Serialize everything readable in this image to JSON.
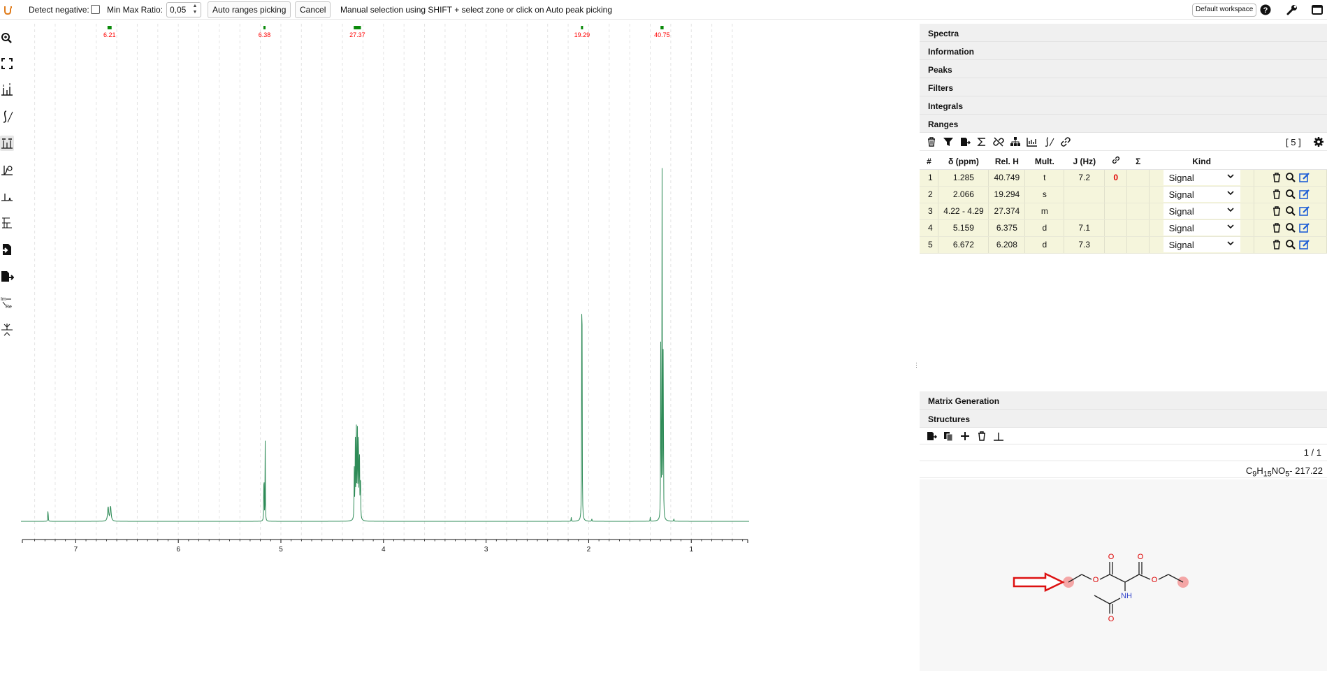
{
  "toolbar": {
    "detect_negative_label": "Detect negative:",
    "detect_negative_checked": false,
    "min_max_ratio_label": "Min Max Ratio:",
    "min_max_ratio_value": "0,05",
    "auto_ranges_label": "Auto ranges picking",
    "cancel_label": "Cancel",
    "hint": "Manual selection using SHIFT + select zone or click on Auto peak picking",
    "workspace_label": "Default workspace",
    "icons": [
      "app-logo-icon",
      "help-icon",
      "wrench-icon",
      "window-icon"
    ]
  },
  "left_tools": [
    "zoom-icon",
    "fullscreen-icon",
    "peak-picking-icon",
    "integral-icon",
    "ranges-picking-icon",
    "phase-correction-icon",
    "baseline-correction-icon",
    "multiplet-analysis-icon",
    "import-icon",
    "export-icon",
    "real-imaginary-icon",
    "spectra-alignment-icon"
  ],
  "chart_data": {
    "type": "line",
    "x_axis": {
      "reversed": true,
      "xlim": [
        7.52,
        0.45
      ],
      "ticks": [
        7,
        6,
        5,
        4,
        3,
        2,
        1
      ],
      "tick_labels": [
        "7",
        "6",
        "5",
        "4",
        "3",
        "2",
        "1"
      ]
    },
    "peaks": [
      {
        "ppm": 7.27,
        "height": 0.04
      },
      {
        "ppm": 6.672,
        "height": 0.038
      },
      {
        "ppm": 5.159,
        "height": 0.2
      },
      {
        "ppm": 4.255,
        "height": 0.25
      },
      {
        "ppm": 2.066,
        "height": 0.96
      },
      {
        "ppm": 1.285,
        "height": 1.0
      },
      {
        "ppm": 2.17,
        "height": 0.01
      },
      {
        "ppm": 1.97,
        "height": 0.008
      },
      {
        "ppm": 1.4,
        "height": 0.01
      },
      {
        "ppm": 1.17,
        "height": 0.008
      }
    ],
    "range_markers": [
      {
        "from": 6.69,
        "to": 6.65,
        "label": "6.21"
      },
      {
        "from": 5.17,
        "to": 5.15,
        "label": "6.38"
      },
      {
        "from": 4.29,
        "to": 4.22,
        "label": "27.37"
      },
      {
        "from": 2.07,
        "to": 2.06,
        "label": "19.29"
      },
      {
        "from": 1.3,
        "to": 1.27,
        "label": "40.75"
      }
    ],
    "line_color": "#2e8b57",
    "marker_color": "#0b8a0b",
    "marker_label_color": "#ff0000",
    "grid": true,
    "grid_style": "dashed-vertical"
  },
  "panel": {
    "sections_top": [
      "Spectra",
      "Information",
      "Peaks",
      "Filters",
      "Integrals",
      "Ranges"
    ],
    "ranges_toolbar_icons": [
      "delete-icon",
      "filter-icon",
      "export-icon",
      "sum-icon",
      "unlink-icon",
      "tree-icon",
      "chart-icon",
      "integral-icon",
      "link-icon"
    ],
    "ranges_count": "[ 5 ]",
    "columns": [
      "#",
      "δ (ppm)",
      "Rel. H",
      "Mult.",
      "J (Hz)",
      "Σ",
      "Kind"
    ],
    "rows": [
      {
        "idx": "1",
        "delta": "1.285",
        "relh": "40.749",
        "mult": "t",
        "j": "7.2",
        "link": "0",
        "kind": "Signal"
      },
      {
        "idx": "2",
        "delta": "2.066",
        "relh": "19.294",
        "mult": "s",
        "j": "",
        "link": "",
        "kind": "Signal"
      },
      {
        "idx": "3",
        "delta": "4.22 - 4.29",
        "relh": "27.374",
        "mult": "m",
        "j": "",
        "link": "",
        "kind": "Signal"
      },
      {
        "idx": "4",
        "delta": "5.159",
        "relh": "6.375",
        "mult": "d",
        "j": "7.1",
        "link": "",
        "kind": "Signal"
      },
      {
        "idx": "5",
        "delta": "6.672",
        "relh": "6.208",
        "mult": "d",
        "j": "7.3",
        "link": "",
        "kind": "Signal"
      }
    ],
    "sections_bottom": [
      "Matrix Generation",
      "Structures"
    ],
    "structures_toolbar_icons": [
      "export-icon",
      "copy-icon",
      "add-icon",
      "delete-icon",
      "peak-icon"
    ],
    "structure_index": "1 / 1",
    "formula_parts": [
      "C",
      "9",
      "H",
      "15",
      "NO",
      "5"
    ],
    "formula_mass": "- 217.22",
    "atom_labels": {
      "O": "O",
      "N": "NH"
    }
  }
}
